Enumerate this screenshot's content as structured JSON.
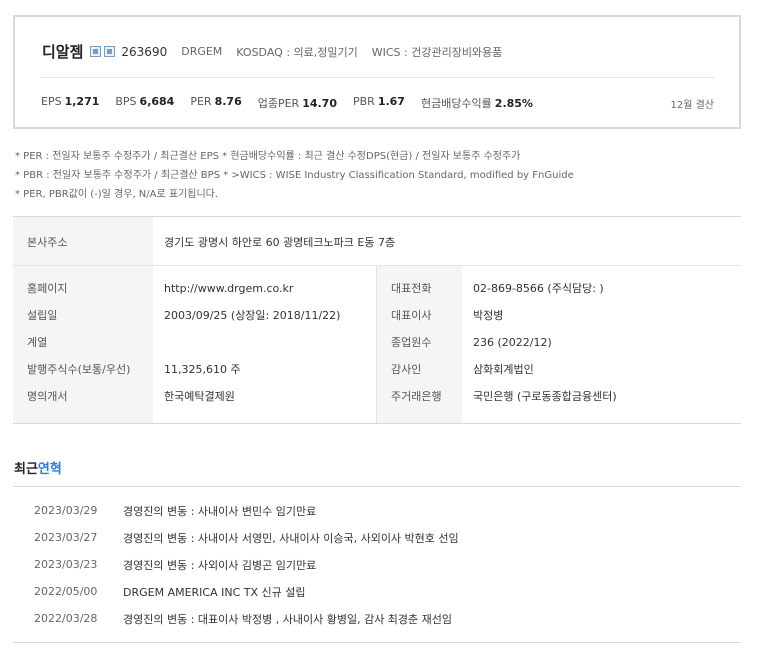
{
  "summary": {
    "name": "디알젬",
    "code": "263690",
    "ticker": "DRGEM",
    "market": "KOSDAQ : 의료,정밀기기",
    "wics": "WICS : 건강관리장비와용품",
    "metrics": [
      {
        "label": "EPS",
        "value": "1,271"
      },
      {
        "label": "BPS",
        "value": "6,684"
      },
      {
        "label": "PER",
        "value": "8.76"
      },
      {
        "label": "업종PER",
        "value": "14.70"
      },
      {
        "label": "PBR",
        "value": "1.67"
      },
      {
        "label": "현금배당수익률",
        "value": "2.85%"
      }
    ],
    "fiscal": "12월 결산"
  },
  "notes": [
    "* PER : 전일자 보통주 수정주가 / 최근결산 EPS * 현금배당수익률 : 최근 결산 수정DPS(현금) / 전일자 보통주 수정주가",
    "* PBR : 전일자 보통주 수정주가 / 최근결산 BPS * >WICS : WISE Industry Classification Standard, modified by FnGuide",
    "* PER, PBR값이 (-)일 경우, N/A로 표기됩니다."
  ],
  "company": {
    "address_label": "본사주소",
    "address": "경기도 광명시 하안로 60 광명테크노파크 E동 7층",
    "left": [
      {
        "label": "홈페이지",
        "value": "http://www.drgem.co.kr"
      },
      {
        "label": "설립일",
        "value": "2003/09/25 (상장일: 2018/11/22)"
      },
      {
        "label": "계열",
        "value": ""
      },
      {
        "label": "발행주식수(보통/우선)",
        "value": "11,325,610 주"
      },
      {
        "label": "명의개서",
        "value": "한국예탁결제원"
      }
    ],
    "right": [
      {
        "label": "대표전화",
        "value": "02-869-8566 (주식담당: )"
      },
      {
        "label": "대표이사",
        "value": "박정병"
      },
      {
        "label": "종업원수",
        "value": "236 (2022/12)"
      },
      {
        "label": "감사인",
        "value": "삼화회계법인"
      },
      {
        "label": "주거래은행",
        "value": "국민은행 (구로동종합금융센터)"
      }
    ]
  },
  "history": {
    "title_plain": "최근",
    "title_accent": "연혁",
    "accent_color": "#2a7de1",
    "events": [
      {
        "date": "2023/03/29",
        "text": "경영진의 변동 : 사내이사 변민수 임기만료"
      },
      {
        "date": "2023/03/27",
        "text": "경영진의 변동 : 사내이사 서영민, 사내이사 이승국, 사외이사 박현호 선임"
      },
      {
        "date": "2023/03/23",
        "text": "경영진의 변동 : 사외이사 김병곤 임기만료"
      },
      {
        "date": "2022/05/00",
        "text": "DRGEM AMERICA INC TX 신규 설립"
      },
      {
        "date": "2022/03/28",
        "text": "경영진의 변동 : 대표이사 박정병 , 사내이사 황병일, 감사 최경춘 재선임"
      }
    ]
  }
}
